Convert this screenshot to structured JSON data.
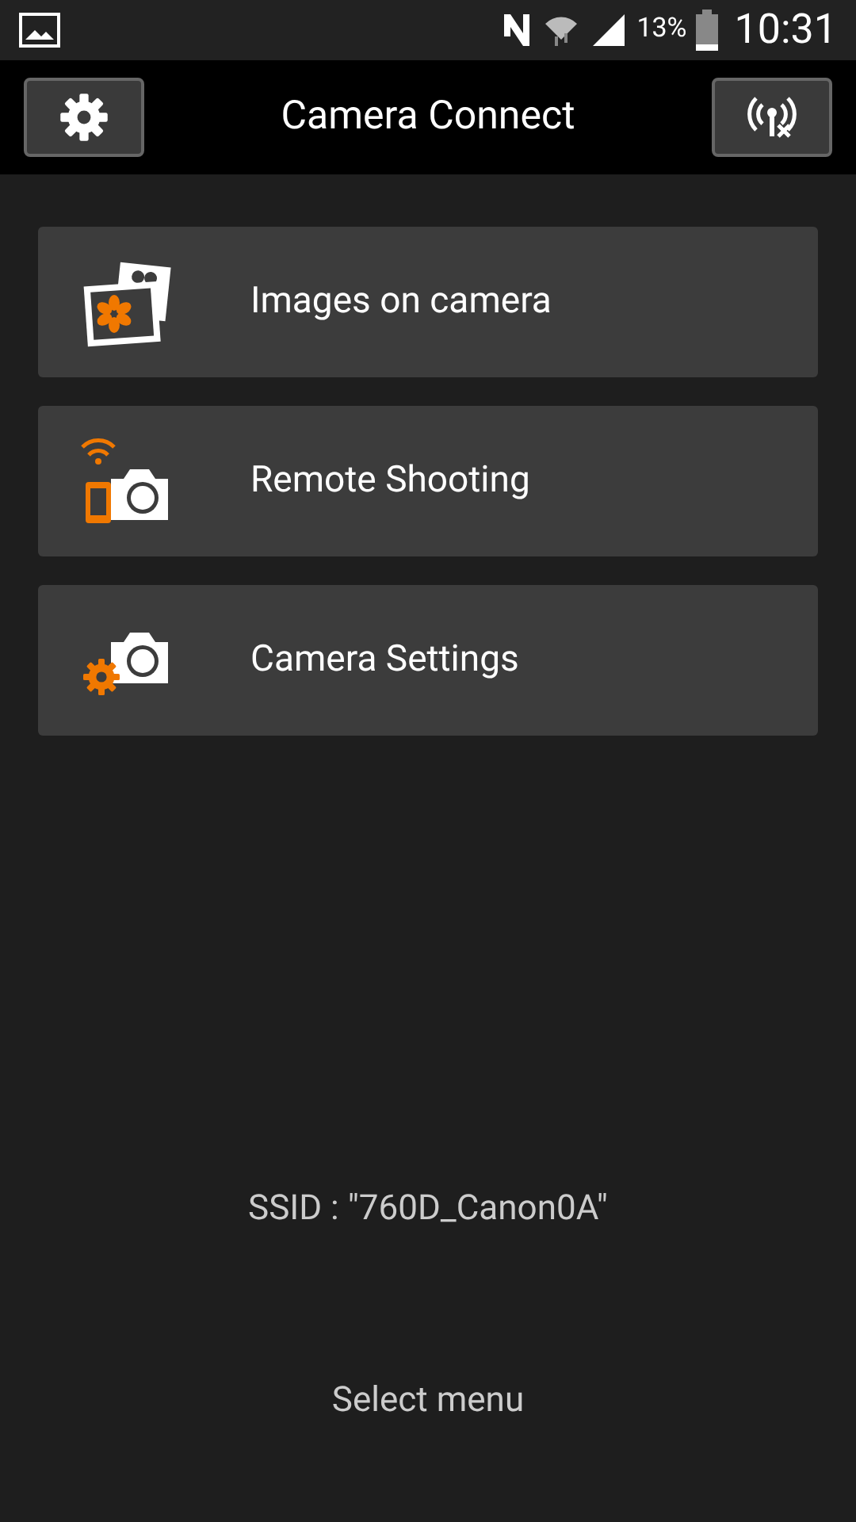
{
  "status_bar": {
    "battery": "13%",
    "time": "10:31"
  },
  "header": {
    "title": "Camera Connect"
  },
  "menu": [
    {
      "kind": "images",
      "label": "Images on camera"
    },
    {
      "kind": "remote",
      "label": "Remote Shooting"
    },
    {
      "kind": "settings",
      "label": "Camera Settings"
    }
  ],
  "ssid": "SSID : \"760D_Canon0A\"",
  "footer": "Select menu"
}
